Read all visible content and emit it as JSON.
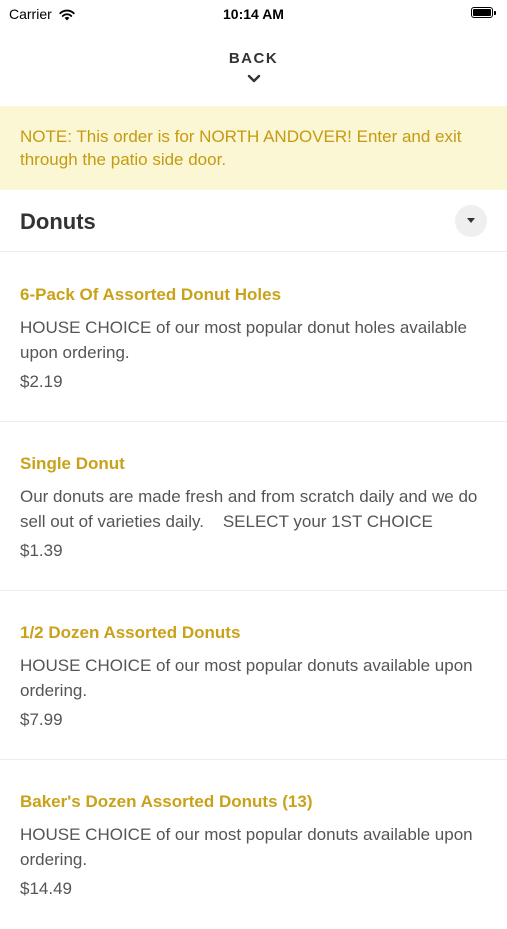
{
  "status_bar": {
    "carrier": "Carrier",
    "time": "10:14 AM"
  },
  "nav": {
    "back_label": "BACK"
  },
  "notice": {
    "text": "NOTE: This order is for NORTH ANDOVER! Enter and exit through the patio side door."
  },
  "section": {
    "title": "Donuts"
  },
  "items": [
    {
      "name": "6-Pack Of Assorted Donut Holes",
      "description": "HOUSE CHOICE of our most popular donut holes available upon ordering.",
      "price": "$2.19"
    },
    {
      "name": "Single Donut",
      "description": "Our donuts are made fresh and from scratch daily and we do sell out of varieties daily.    SELECT your 1ST CHOICE",
      "price": "$1.39"
    },
    {
      "name": "1/2 Dozen Assorted Donuts",
      "description": "HOUSE CHOICE of our most popular donuts available upon ordering.",
      "price": "$7.99"
    },
    {
      "name": "Baker's Dozen Assorted Donuts (13)",
      "description": "HOUSE CHOICE of our most popular donuts available upon ordering.",
      "price": "$14.49"
    }
  ],
  "colors": {
    "accent": "#c9a21a",
    "notice_bg": "#fbf6d3",
    "notice_text": "#c59b12"
  },
  "icons": [
    "wifi-icon",
    "battery-icon",
    "chevron-down-icon",
    "caret-down-icon"
  ]
}
